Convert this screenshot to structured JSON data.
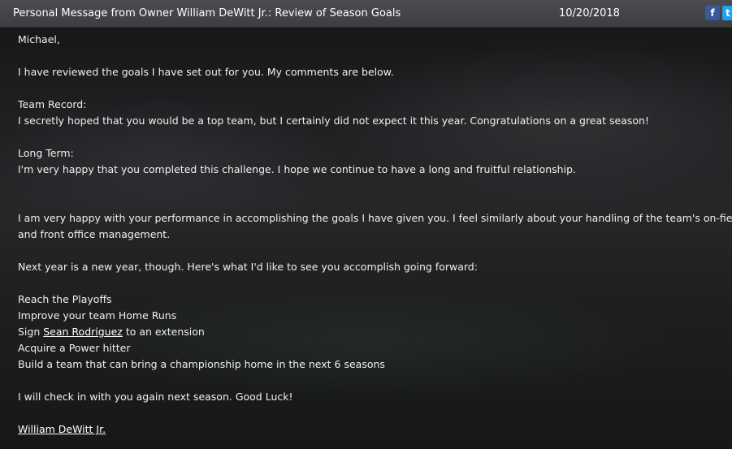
{
  "header": {
    "title": "Personal Message from Owner William DeWitt Jr.: Review of Season Goals",
    "date": "10/20/2018",
    "facebook_glyph": "f",
    "twitter_glyph": "t"
  },
  "message": {
    "greeting": "Michael,",
    "intro": "I have reviewed the goals I have set out for you.  My comments are below.",
    "team_record_heading": "Team Record:",
    "team_record_text": "I secretly hoped that you would be a top team, but I certainly did not expect it this year. Congratulations on a great season!",
    "long_term_heading": "Long Term:",
    "long_term_text": "I'm very happy that you completed this challenge. I hope we continue to have a long and fruitful relationship.",
    "performance_line1": "I am very happy with your performance in accomplishing the goals I have given you. I feel similarly about your handling of the team's on-field",
    "performance_line2": "and front office management.",
    "next_year": "Next year is a new year, though.  Here's what I'd like to see you accomplish going forward:",
    "goals": {
      "goal1": "Reach the Playoffs",
      "goal2": "Improve your team Home Runs",
      "goal3_prefix": "Sign ",
      "goal3_player": "Sean Rodriguez",
      "goal3_suffix": " to an extension",
      "goal4": "Acquire a Power hitter",
      "goal5": "Build a team that can bring a championship home in the next 6 seasons"
    },
    "closing": "I will check in with you again next season.  Good Luck!",
    "signature": "William DeWitt Jr."
  }
}
